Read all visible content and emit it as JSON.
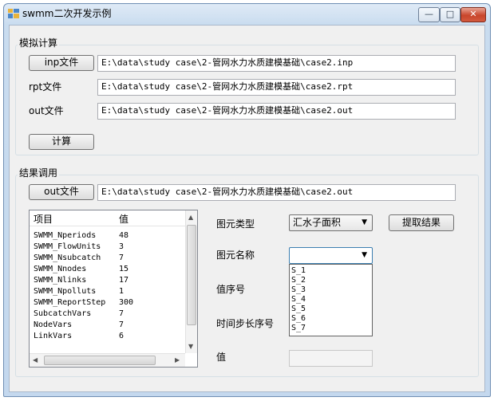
{
  "window": {
    "title": "swmm二次开发示例",
    "minimize_glyph": "—",
    "maximize_glyph": "□",
    "close_glyph": "✕",
    "app_icon": "app-window-icon"
  },
  "simulation": {
    "group_title": "模拟计算",
    "inp_button": "inp文件",
    "inp_path": "E:\\data\\study case\\2-管网水力水质建模基础\\case2.inp",
    "rpt_label": "rpt文件",
    "rpt_path": "E:\\data\\study case\\2-管网水力水质建模基础\\case2.rpt",
    "out_label": "out文件",
    "out_path": "E:\\data\\study case\\2-管网水力水质建模基础\\case2.out",
    "calc_button": "计算"
  },
  "results": {
    "group_title": "结果调用",
    "out_button": "out文件",
    "out_path": "E:\\data\\study case\\2-管网水力水质建模基础\\case2.out",
    "table": {
      "col_item": "项目",
      "col_value": "值",
      "rows": [
        {
          "item": "SWMM_Nperiods",
          "value": "48"
        },
        {
          "item": "SWMM_FlowUnits",
          "value": "3"
        },
        {
          "item": "SWMM_Nsubcatch",
          "value": "7"
        },
        {
          "item": "SWMM_Nnodes",
          "value": "15"
        },
        {
          "item": "SWMM_Nlinks",
          "value": "17"
        },
        {
          "item": "SWMM_Npolluts",
          "value": "1"
        },
        {
          "item": "SWMM_ReportStep",
          "value": "300"
        },
        {
          "item": "SubcatchVars",
          "value": "7"
        },
        {
          "item": "NodeVars",
          "value": "7"
        },
        {
          "item": "LinkVars",
          "value": "6"
        }
      ]
    },
    "element_type_label": "图元类型",
    "element_type_value": "汇水子面积",
    "fetch_button": "提取结果",
    "element_name_label": "图元名称",
    "element_name_value": "",
    "element_name_options": [
      "S_1",
      "S_2",
      "S_3",
      "S_4",
      "S_5",
      "S_6",
      "S_7"
    ],
    "value_index_label": "值序号",
    "time_step_label": "时间步长序号",
    "value_label": "值",
    "value_text": ""
  }
}
